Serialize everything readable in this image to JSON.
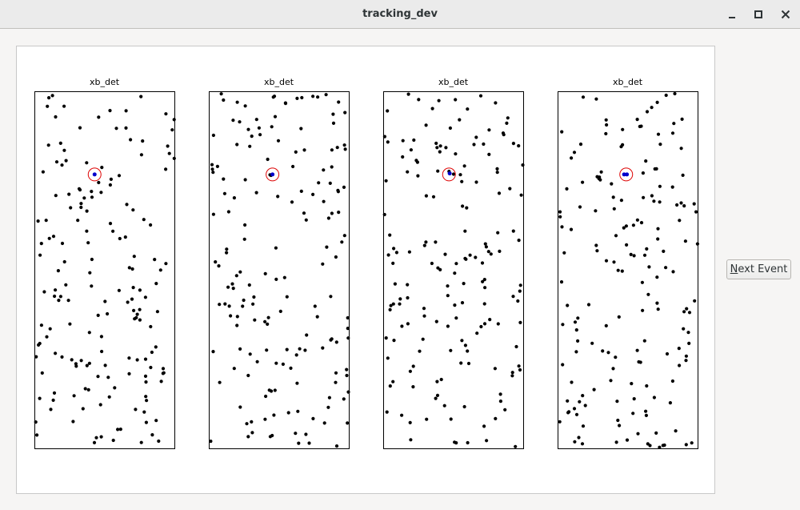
{
  "window": {
    "title": "tracking_dev",
    "controls": [
      "minimize-icon",
      "maximize-icon",
      "close-icon"
    ]
  },
  "buttons": {
    "next_event_mnemonic": "N",
    "next_event_rest": "ext Event"
  },
  "panels": [
    {
      "title": "xb_det",
      "highlight": {
        "circle": [
          0.43,
          0.233
        ],
        "blue_points": [
          [
            0.43,
            0.233
          ]
        ]
      }
    },
    {
      "title": "xb_det",
      "highlight": {
        "circle": [
          0.455,
          0.233
        ],
        "blue_points": [
          [
            0.455,
            0.233
          ]
        ]
      }
    },
    {
      "title": "xb_det",
      "highlight": {
        "circle": [
          0.47,
          0.233
        ],
        "blue_points": [
          [
            0.475,
            0.23
          ]
        ]
      }
    },
    {
      "title": "xb_det",
      "highlight": {
        "circle": [
          0.49,
          0.233
        ],
        "blue_points": [
          [
            0.475,
            0.233
          ],
          [
            0.495,
            0.233
          ]
        ]
      }
    }
  ],
  "plot_style": {
    "point_color": "#000000",
    "highlight_point_color": "#0000cc",
    "circle_color": "#dd0000"
  }
}
